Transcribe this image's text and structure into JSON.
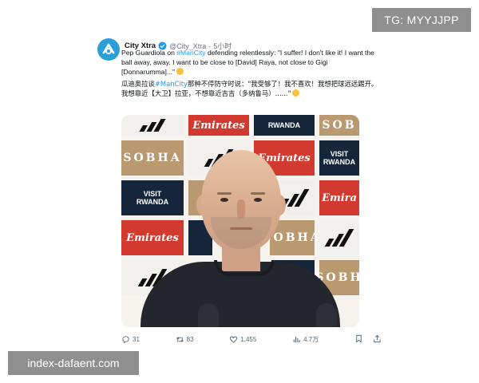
{
  "watermark_top": "TG: MYYJJPP",
  "watermark_bottom": "index-dafaent.com",
  "tweet": {
    "display_name": "City Xtra",
    "handle": "@City_Xtra",
    "separator": "·",
    "time": "5小时",
    "text_en_1": "Pep Guardiola on ",
    "hashtag": "#ManCity",
    "text_en_2": " defending relentlessly: \"I suffer! I don't like it! I want the ball away, away. I want to be close to [David] Raya, not close to Gigi [Donnarumma]...\"",
    "text_cn_1": "瓜迪奥拉谈",
    "text_cn_2": "那种不停防守时说：\"我受够了！我不喜欢！我想把球远远踢开。我想靠近【大卫】拉亚，不想靠近吉吉（多纳鲁马）......\"",
    "emoji": "😢",
    "board": {
      "emirates": "Emirates",
      "emirates_partial": "Emira",
      "sobha": "SOBHA",
      "sobha_partial": "SOBH",
      "sobha_partial2": "SOB",
      "rwanda_visit": "VISIT",
      "rwanda": "RWANDA"
    }
  },
  "actions": {
    "replies": "31",
    "retweets": "83",
    "likes": "1,455",
    "views": "4.7万"
  },
  "colors": {
    "link": "#1d9bf0",
    "emirates_red": "#d23a2f",
    "sobha_tan": "#b99970",
    "rwanda_navy": "#15263b",
    "avatar_blue": "#2a9fd8"
  },
  "icons": [
    "city-xtra-logo-icon",
    "verified-icon",
    "reply-icon",
    "retweet-icon",
    "like-icon",
    "views-icon",
    "bookmark-icon",
    "share-icon"
  ]
}
